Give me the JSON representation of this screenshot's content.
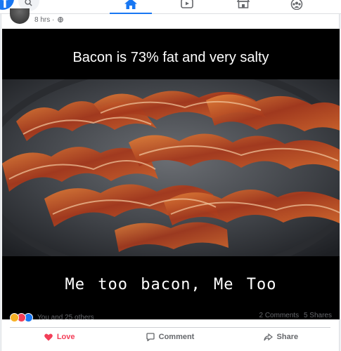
{
  "nav": {
    "logo_glyph": "f",
    "tabs": [
      {
        "name": "home",
        "icon": "home-icon",
        "active": true
      },
      {
        "name": "watch",
        "icon": "watch-icon",
        "active": false
      },
      {
        "name": "marketplace",
        "icon": "marketplace-icon",
        "active": false
      },
      {
        "name": "groups",
        "icon": "groups-icon",
        "active": false
      }
    ],
    "accent_color": "#1877f2"
  },
  "post": {
    "time": "8 hrs ·",
    "image": {
      "caption_top": "Bacon is 73% fat and very salty",
      "caption_bottom": "Me too bacon, Me Too"
    },
    "reactions": {
      "icons": [
        "haha-icon",
        "love-icon",
        "like-icon"
      ],
      "summary": "You and 25 others"
    },
    "comments_count": "2 Comments",
    "shares_count": "5 Shares",
    "actions": {
      "love_label": "Love",
      "comment_label": "Comment",
      "share_label": "Share"
    },
    "colors": {
      "love": "#f33e58",
      "muted_text": "#65676b"
    }
  }
}
